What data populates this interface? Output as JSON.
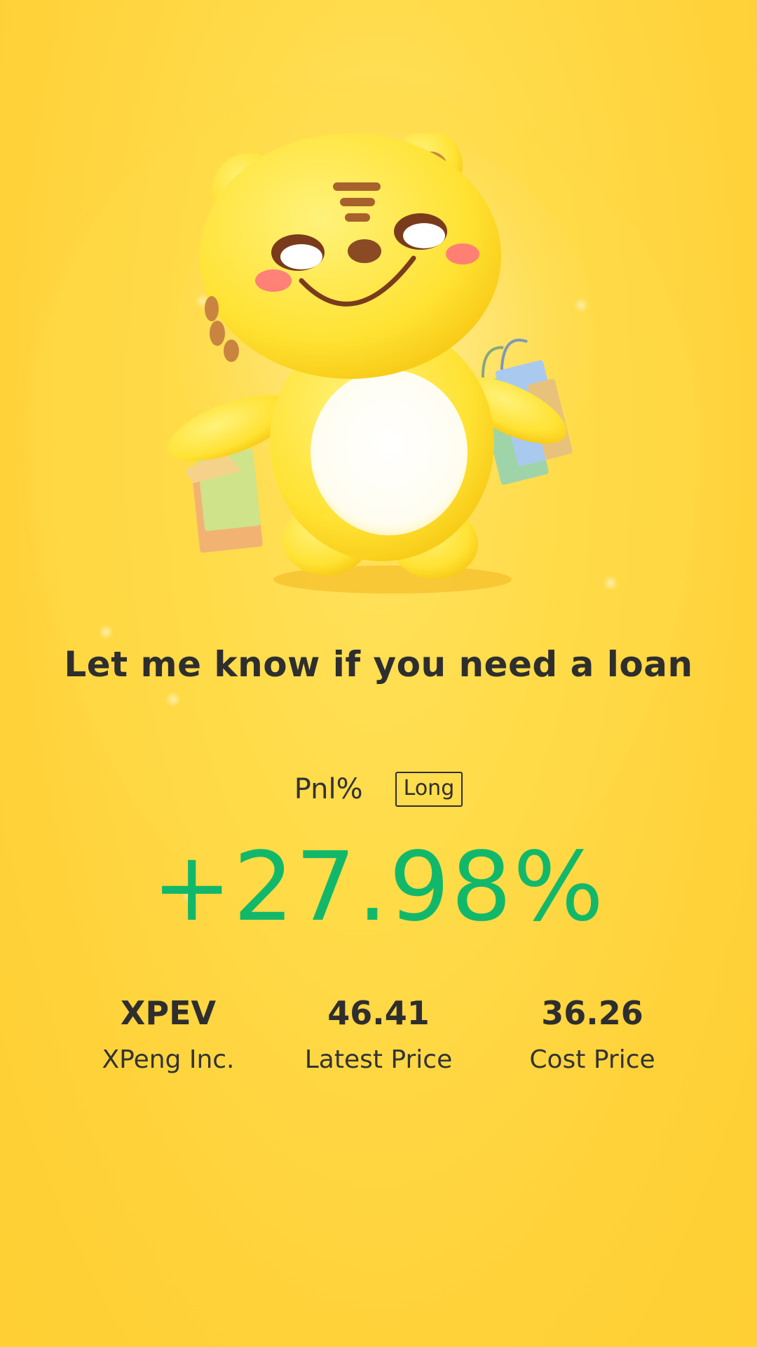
{
  "promo": {
    "headline": "Let me know if you need a loan"
  },
  "pnl": {
    "label": "Pnl%",
    "direction": "Long",
    "value": "+27.98%"
  },
  "stats": [
    {
      "value": "XPEV",
      "label": "XPeng Inc."
    },
    {
      "value": "46.41",
      "label": "Latest Price"
    },
    {
      "value": "36.26",
      "label": "Cost Price"
    }
  ],
  "colors": {
    "background": "#ffd23a",
    "profit": "#12b86a",
    "text": "#2e2e2e"
  },
  "icons": {
    "mascot": "tiger-mascot-with-shopping-bags-icon"
  }
}
